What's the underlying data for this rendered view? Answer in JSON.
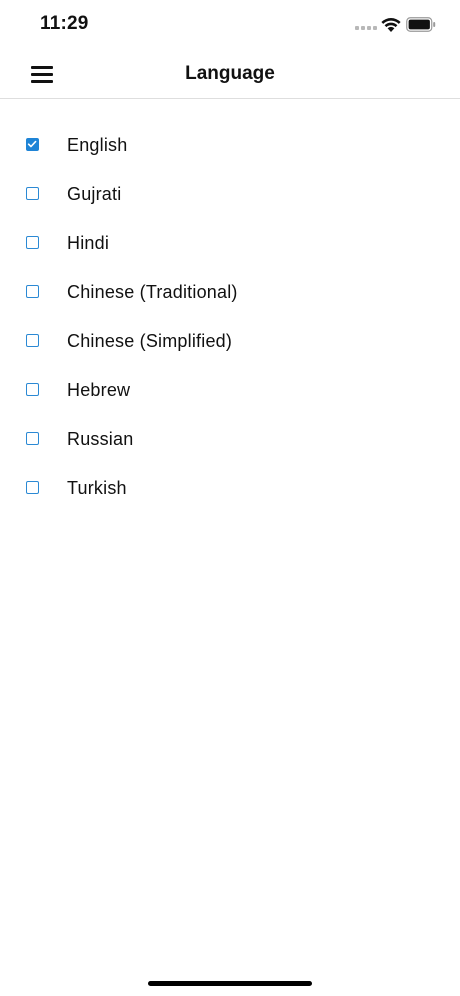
{
  "status_bar": {
    "time": "11:29",
    "icons": [
      "cellular-signal-icon",
      "wifi-icon",
      "battery-icon"
    ]
  },
  "header": {
    "title": "Language",
    "menu_icon": "hamburger-menu-icon"
  },
  "languages": [
    {
      "label": "English",
      "checked": true
    },
    {
      "label": "Gujrati",
      "checked": false
    },
    {
      "label": "Hindi",
      "checked": false
    },
    {
      "label": "Chinese (Traditional)",
      "checked": false
    },
    {
      "label": "Chinese (Simplified)",
      "checked": false
    },
    {
      "label": "Hebrew",
      "checked": false
    },
    {
      "label": "Russian",
      "checked": false
    },
    {
      "label": "Turkish",
      "checked": false
    }
  ],
  "colors": {
    "accent": "#1f84d6",
    "text": "#111111",
    "divider": "#dedede",
    "background": "#ffffff"
  }
}
